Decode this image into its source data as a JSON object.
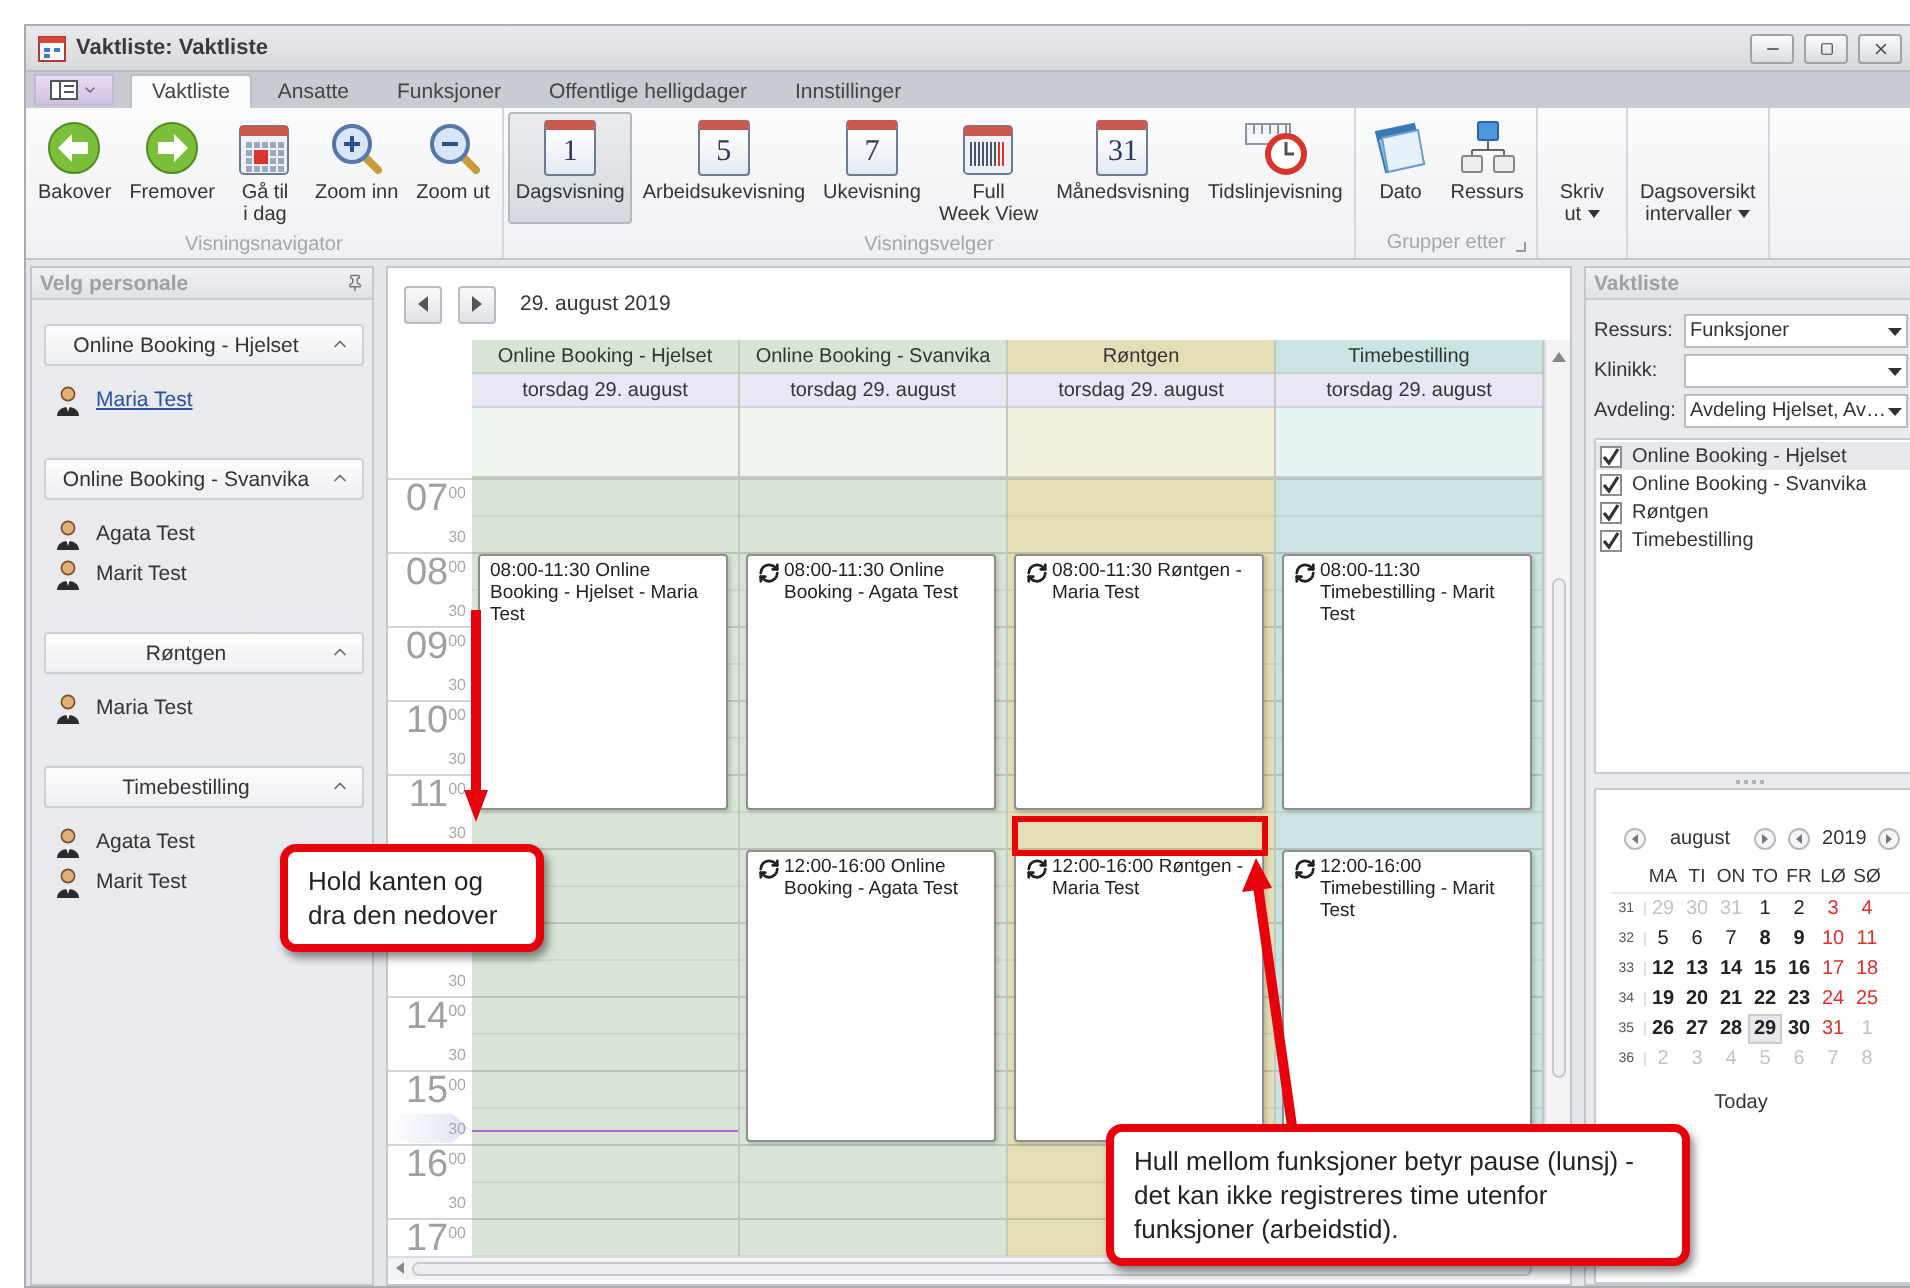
{
  "window": {
    "title": "Vaktliste: Vaktliste"
  },
  "ribbon_tabs": [
    {
      "label": "Vaktliste",
      "selected": true
    },
    {
      "label": "Ansatte",
      "selected": false
    },
    {
      "label": "Funksjoner",
      "selected": false
    },
    {
      "label": "Offentlige helligdager",
      "selected": false
    },
    {
      "label": "Innstillinger",
      "selected": false
    }
  ],
  "ribbon_groups": [
    {
      "label": "Visningsnavigator",
      "buttons": [
        {
          "kind": "back",
          "label": "Bakover",
          "selected": false
        },
        {
          "kind": "forward",
          "label": "Fremover",
          "selected": false
        },
        {
          "kind": "today",
          "label": "Gå til\ni dag",
          "selected": false
        },
        {
          "kind": "zoom-in",
          "label": "Zoom inn",
          "selected": false
        },
        {
          "kind": "zoom-out",
          "label": "Zoom ut",
          "selected": false
        }
      ]
    },
    {
      "label": "Visningsvelger",
      "buttons": [
        {
          "kind": "calendar",
          "icon_text": "1",
          "label": "Dagsvisning",
          "selected": true
        },
        {
          "kind": "calendar",
          "icon_text": "5",
          "label": "Arbeidsukevisning",
          "selected": false
        },
        {
          "kind": "calendar",
          "icon_text": "7",
          "label": "Ukevisning",
          "selected": false
        },
        {
          "kind": "full-week",
          "label": "Full\nWeek View",
          "selected": false
        },
        {
          "kind": "calendar",
          "icon_text": "31",
          "label": "Månedsvisning",
          "selected": false
        },
        {
          "kind": "timeline",
          "label": "Tidslinjevisning",
          "selected": false
        }
      ]
    },
    {
      "label": "Grupper etter",
      "launcher": true,
      "buttons": [
        {
          "kind": "date",
          "label": "Dato",
          "selected": false
        },
        {
          "kind": "resource",
          "label": "Ressurs",
          "selected": false
        }
      ]
    },
    {
      "buttons": [
        {
          "kind": "dropdown",
          "label": "Skriv\nut",
          "selected": false
        }
      ]
    },
    {
      "buttons": [
        {
          "kind": "dropdown",
          "label": "Dagsoversikt\nintervaller",
          "selected": false
        }
      ]
    }
  ],
  "staff_panel": {
    "title": "Velg personale",
    "groups": [
      {
        "name": "Online Booking - Hjelset",
        "expanded": true,
        "people": [
          {
            "name": "Maria Test",
            "hovered": true
          }
        ]
      },
      {
        "name": "Online Booking - Svanvika",
        "expanded": true,
        "people": [
          {
            "name": "Agata Test",
            "hovered": false
          },
          {
            "name": "Marit Test",
            "hovered": false
          }
        ]
      },
      {
        "name": "Røntgen",
        "expanded": true,
        "people": [
          {
            "name": "Maria Test",
            "hovered": false
          }
        ]
      },
      {
        "name": "Timebestilling",
        "expanded": true,
        "people": [
          {
            "name": "Agata Test",
            "hovered": false
          },
          {
            "name": "Marit Test",
            "hovered": false
          }
        ]
      }
    ]
  },
  "calendar": {
    "date": "29. august 2019",
    "ruler": [
      {
        "kind": "hour",
        "hour": "07",
        "minutes": "00"
      },
      {
        "kind": "half",
        "minutes": "30"
      },
      {
        "kind": "hour",
        "hour": "08",
        "minutes": "00"
      },
      {
        "kind": "half",
        "minutes": "30"
      },
      {
        "kind": "hour",
        "hour": "09",
        "minutes": "00"
      },
      {
        "kind": "half",
        "minutes": "30"
      },
      {
        "kind": "hour",
        "hour": "10",
        "minutes": "00"
      },
      {
        "kind": "half",
        "minutes": "30"
      },
      {
        "kind": "hour",
        "hour": "11",
        "minutes": "00"
      },
      {
        "kind": "half",
        "minutes": "30"
      },
      {
        "kind": "covered"
      },
      {
        "kind": "covered"
      },
      {
        "kind": "covered"
      },
      {
        "kind": "half",
        "minutes": "30"
      },
      {
        "kind": "hour",
        "hour": "14",
        "minutes": "00"
      },
      {
        "kind": "half",
        "minutes": "30"
      },
      {
        "kind": "hour",
        "hour": "15",
        "minutes": "00"
      },
      {
        "kind": "now",
        "minutes": "30"
      },
      {
        "kind": "hour",
        "hour": "16",
        "minutes": "00"
      },
      {
        "kind": "half",
        "minutes": "30"
      },
      {
        "kind": "hour",
        "hour": "17",
        "minutes": "00"
      }
    ],
    "columns": [
      {
        "resource": "Online Booking - Hjelset",
        "date": "torsdag 29. august",
        "color": "#d8e5d6",
        "events": [
          {
            "time": "08:00-11:30",
            "title": "Online Booking - Hjelset - Maria Test",
            "recurring": false
          }
        ]
      },
      {
        "resource": "Online Booking - Svanvika",
        "date": "torsdag 29. august",
        "color": "#d8e5d6",
        "events": [
          {
            "time": "08:00-11:30",
            "title": "Online Booking - Agata Test",
            "recurring": true
          },
          {
            "time": "12:00-16:00",
            "title": "Online Booking - Agata Test",
            "recurring": true
          }
        ]
      },
      {
        "resource": "Røntgen",
        "date": "torsdag 29. august",
        "color": "#e4deb6",
        "events": [
          {
            "time": "08:00-11:30",
            "title": "Røntgen - Maria Test",
            "recurring": true
          },
          {
            "time": "12:00-16:00",
            "title": "Røntgen - Maria Test",
            "recurring": true
          }
        ]
      },
      {
        "resource": "Timebestilling",
        "date": "torsdag 29. august",
        "color": "#c9e4e2",
        "events": [
          {
            "time": "08:00-11:30",
            "title": "Timebestilling - Marit Test",
            "recurring": true
          },
          {
            "time": "12:00-16:00",
            "title": "Timebestilling - Marit Test",
            "recurring": true
          }
        ]
      }
    ]
  },
  "schedule_panel": {
    "title": "Vaktliste",
    "filters": [
      {
        "label": "Ressurs:",
        "value": "Funksjoner"
      },
      {
        "label": "Klinikk:"
      },
      {
        "label": "Avdeling:",
        "value": "Avdeling Hjelset, Av…"
      }
    ],
    "resources": [
      {
        "label": "Online Booking - Hjelset",
        "checked": true,
        "selected": true
      },
      {
        "label": "Online Booking - Svanvika",
        "checked": true,
        "selected": false
      },
      {
        "label": "Røntgen",
        "checked": true,
        "selected": false
      },
      {
        "label": "Timebestilling",
        "checked": true,
        "selected": false
      }
    ],
    "mini_calendar": {
      "month": "august",
      "year": "2019",
      "weekdays": [
        "MA",
        "TI",
        "ON",
        "TO",
        "FR",
        "LØ",
        "SØ"
      ],
      "today_label": "Today",
      "weeks": [
        {
          "number": "31",
          "days": [
            {
              "day": "29",
              "kind": "other",
              "bold": false,
              "selected": false
            },
            {
              "day": "30",
              "kind": "other",
              "bold": false,
              "selected": false
            },
            {
              "day": "31",
              "kind": "other",
              "bold": false,
              "selected": false
            },
            {
              "day": "1",
              "kind": "weekday",
              "bold": false,
              "selected": false
            },
            {
              "day": "2",
              "kind": "weekday",
              "bold": false,
              "selected": false
            },
            {
              "day": "3",
              "kind": "weekend",
              "bold": false,
              "selected": false
            },
            {
              "day": "4",
              "kind": "weekend",
              "bold": false,
              "selected": false
            }
          ]
        },
        {
          "number": "32",
          "days": [
            {
              "day": "5",
              "kind": "weekday",
              "bold": false,
              "selected": false
            },
            {
              "day": "6",
              "kind": "weekday",
              "bold": false,
              "selected": false
            },
            {
              "day": "7",
              "kind": "weekday",
              "bold": false,
              "selected": false
            },
            {
              "day": "8",
              "kind": "weekday",
              "bold": true,
              "selected": false
            },
            {
              "day": "9",
              "kind": "weekday",
              "bold": true,
              "selected": false
            },
            {
              "day": "10",
              "kind": "weekend",
              "bold": false,
              "selected": false
            },
            {
              "day": "11",
              "kind": "weekend",
              "bold": false,
              "selected": false
            }
          ]
        },
        {
          "number": "33",
          "days": [
            {
              "day": "12",
              "kind": "weekday",
              "bold": true,
              "selected": false
            },
            {
              "day": "13",
              "kind": "weekday",
              "bold": true,
              "selected": false
            },
            {
              "day": "14",
              "kind": "weekday",
              "bold": true,
              "selected": false
            },
            {
              "day": "15",
              "kind": "weekday",
              "bold": true,
              "selected": false
            },
            {
              "day": "16",
              "kind": "weekday",
              "bold": true,
              "selected": false
            },
            {
              "day": "17",
              "kind": "weekend",
              "bold": false,
              "selected": false
            },
            {
              "day": "18",
              "kind": "weekend",
              "bold": false,
              "selected": false
            }
          ]
        },
        {
          "number": "34",
          "days": [
            {
              "day": "19",
              "kind": "weekday",
              "bold": true,
              "selected": false
            },
            {
              "day": "20",
              "kind": "weekday",
              "bold": true,
              "selected": false
            },
            {
              "day": "21",
              "kind": "weekday",
              "bold": true,
              "selected": false
            },
            {
              "day": "22",
              "kind": "weekday",
              "bold": true,
              "selected": false
            },
            {
              "day": "23",
              "kind": "weekday",
              "bold": true,
              "selected": false
            },
            {
              "day": "24",
              "kind": "weekend",
              "bold": false,
              "selected": false
            },
            {
              "day": "25",
              "kind": "weekend",
              "bold": false,
              "selected": false
            }
          ]
        },
        {
          "number": "35",
          "days": [
            {
              "day": "26",
              "kind": "weekday",
              "bold": true,
              "selected": false
            },
            {
              "day": "27",
              "kind": "weekday",
              "bold": true,
              "selected": false
            },
            {
              "day": "28",
              "kind": "weekday",
              "bold": true,
              "selected": false
            },
            {
              "day": "29",
              "kind": "weekday",
              "bold": true,
              "selected": true
            },
            {
              "day": "30",
              "kind": "weekday",
              "bold": true,
              "selected": false
            },
            {
              "day": "31",
              "kind": "weekend",
              "bold": false,
              "selected": false
            },
            {
              "day": "1",
              "kind": "other",
              "bold": false,
              "selected": false
            }
          ]
        },
        {
          "number": "36",
          "days": [
            {
              "day": "2",
              "kind": "other",
              "bold": false,
              "selected": false
            },
            {
              "day": "3",
              "kind": "other",
              "bold": false,
              "selected": false
            },
            {
              "day": "4",
              "kind": "other",
              "bold": false,
              "selected": false
            },
            {
              "day": "5",
              "kind": "other",
              "bold": false,
              "selected": false
            },
            {
              "day": "6",
              "kind": "other",
              "bold": false,
              "selected": false
            },
            {
              "day": "7",
              "kind": "other",
              "bold": false,
              "selected": false
            },
            {
              "day": "8",
              "kind": "other",
              "bold": false,
              "selected": false
            }
          ]
        }
      ]
    }
  },
  "annotations": [
    {
      "kind": "callout",
      "text": "Hold kanten og dra den nedover"
    },
    {
      "kind": "callout",
      "text": "Hull mellom funksjoner betyr pause (lunsj) - det kan ikke registreres time utenfor funksjoner (arbeidstid)."
    }
  ]
}
